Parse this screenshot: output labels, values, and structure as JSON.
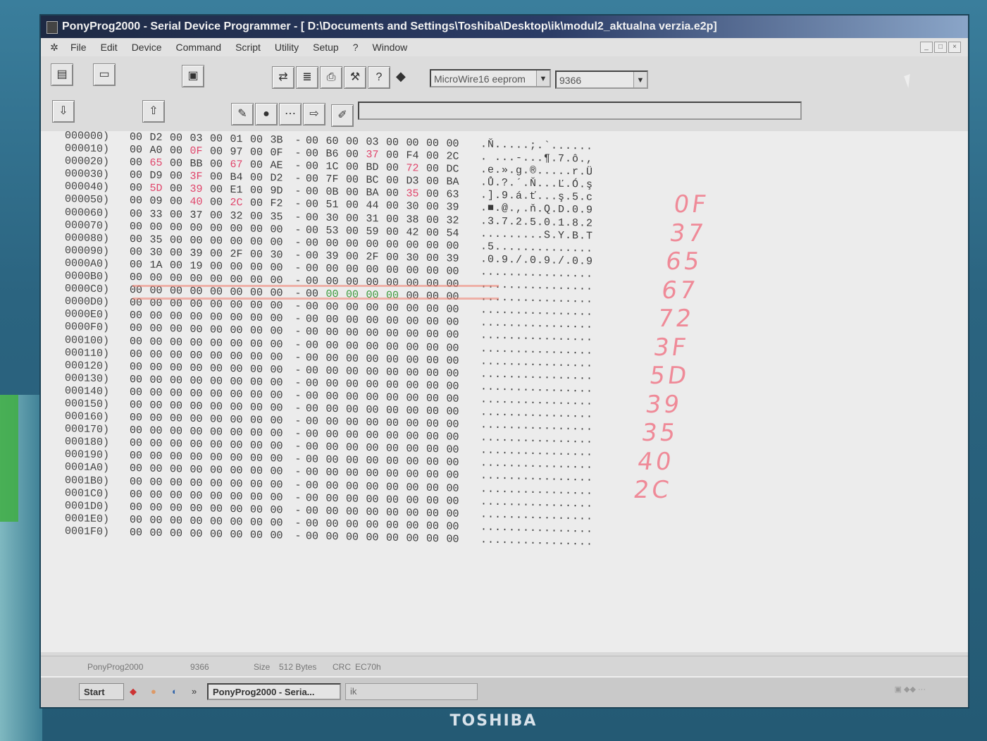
{
  "window": {
    "title": "PonyProg2000 - Serial Device Programmer - [ D:\\Documents and Settings\\Toshiba\\Desktop\\ik\\modul2_aktualna verzia.e2p]"
  },
  "menu": [
    "File",
    "Edit",
    "Device",
    "Command",
    "Script",
    "Utility",
    "Setup",
    "?",
    "Window"
  ],
  "toolbar": {
    "device_family": "MicroWire16 eeprom",
    "device_type": "9366"
  },
  "hex": {
    "rows": [
      {
        "addr": "000000)",
        "bytes": [
          "00",
          "D2",
          "00",
          "03",
          "00",
          "01",
          "00",
          "3B",
          "00",
          "60",
          "00",
          "03",
          "00",
          "00",
          "00",
          "00"
        ],
        "ascii": ".Ň.....;.`......"
      },
      {
        "addr": "000010)",
        "bytes": [
          "00",
          "A0",
          "00",
          "0F",
          "00",
          "97",
          "00",
          "0F",
          "00",
          "B6",
          "00",
          "37",
          "00",
          "F4",
          "00",
          "2C"
        ],
        "ascii": ". ...-...¶.7.ô.,"
      },
      {
        "addr": "000020)",
        "bytes": [
          "00",
          "65",
          "00",
          "BB",
          "00",
          "67",
          "00",
          "AE",
          "00",
          "1C",
          "00",
          "BD",
          "00",
          "72",
          "00",
          "DC"
        ],
        "ascii": ".e.».g.®.....r.Ü"
      },
      {
        "addr": "000030)",
        "bytes": [
          "00",
          "D9",
          "00",
          "3F",
          "00",
          "B4",
          "00",
          "D2",
          "00",
          "7F",
          "00",
          "BC",
          "00",
          "D3",
          "00",
          "BA"
        ],
        "ascii": ".Ů.?.´.Ň...Ľ.Ó.ş"
      },
      {
        "addr": "000040)",
        "bytes": [
          "00",
          "5D",
          "00",
          "39",
          "00",
          "E1",
          "00",
          "9D",
          "00",
          "0B",
          "00",
          "BA",
          "00",
          "35",
          "00",
          "63"
        ],
        "ascii": ".].9.á.ť...ş.5.c"
      },
      {
        "addr": "000050)",
        "bytes": [
          "00",
          "09",
          "00",
          "40",
          "00",
          "2C",
          "00",
          "F2",
          "00",
          "51",
          "00",
          "44",
          "00",
          "30",
          "00",
          "39"
        ],
        "ascii": ".■.@.,.ň.Q.D.0.9"
      },
      {
        "addr": "000060)",
        "bytes": [
          "00",
          "33",
          "00",
          "37",
          "00",
          "32",
          "00",
          "35",
          "00",
          "30",
          "00",
          "31",
          "00",
          "38",
          "00",
          "32"
        ],
        "ascii": ".3.7.2.5.0.1.8.2"
      },
      {
        "addr": "000070)",
        "bytes": [
          "00",
          "00",
          "00",
          "00",
          "00",
          "00",
          "00",
          "00",
          "00",
          "53",
          "00",
          "59",
          "00",
          "42",
          "00",
          "54"
        ],
        "ascii": ".........S.Y.B.T"
      },
      {
        "addr": "000080)",
        "bytes": [
          "00",
          "35",
          "00",
          "00",
          "00",
          "00",
          "00",
          "00",
          "00",
          "00",
          "00",
          "00",
          "00",
          "00",
          "00",
          "00"
        ],
        "ascii": ".5.............."
      },
      {
        "addr": "000090)",
        "bytes": [
          "00",
          "30",
          "00",
          "39",
          "00",
          "2F",
          "00",
          "30",
          "00",
          "39",
          "00",
          "2F",
          "00",
          "30",
          "00",
          "39"
        ],
        "ascii": ".0.9./.0.9./.0.9"
      },
      {
        "addr": "0000A0)",
        "bytes": [
          "00",
          "1A",
          "00",
          "19",
          "00",
          "00",
          "00",
          "00",
          "00",
          "00",
          "00",
          "00",
          "00",
          "00",
          "00",
          "00"
        ],
        "ascii": "................"
      },
      {
        "addr": "0000B0)",
        "bytes": [
          "00",
          "00",
          "00",
          "00",
          "00",
          "00",
          "00",
          "00",
          "00",
          "00",
          "00",
          "00",
          "00",
          "00",
          "00",
          "00"
        ],
        "ascii": "................"
      },
      {
        "addr": "0000C0)",
        "bytes": [
          "00",
          "00",
          "00",
          "00",
          "00",
          "00",
          "00",
          "00",
          "00",
          "00",
          "00",
          "00",
          "00",
          "00",
          "00",
          "00"
        ],
        "ascii": "................"
      },
      {
        "addr": "0000D0)",
        "bytes": [
          "00",
          "00",
          "00",
          "00",
          "00",
          "00",
          "00",
          "00",
          "00",
          "00",
          "00",
          "00",
          "00",
          "00",
          "00",
          "00"
        ],
        "ascii": "................"
      },
      {
        "addr": "0000E0)",
        "bytes": [
          "00",
          "00",
          "00",
          "00",
          "00",
          "00",
          "00",
          "00",
          "00",
          "00",
          "00",
          "00",
          "00",
          "00",
          "00",
          "00"
        ],
        "ascii": "................"
      },
      {
        "addr": "0000F0)",
        "bytes": [
          "00",
          "00",
          "00",
          "00",
          "00",
          "00",
          "00",
          "00",
          "00",
          "00",
          "00",
          "00",
          "00",
          "00",
          "00",
          "00"
        ],
        "ascii": "................"
      },
      {
        "addr": "000100)",
        "bytes": [
          "00",
          "00",
          "00",
          "00",
          "00",
          "00",
          "00",
          "00",
          "00",
          "00",
          "00",
          "00",
          "00",
          "00",
          "00",
          "00"
        ],
        "ascii": "................"
      },
      {
        "addr": "000110)",
        "bytes": [
          "00",
          "00",
          "00",
          "00",
          "00",
          "00",
          "00",
          "00",
          "00",
          "00",
          "00",
          "00",
          "00",
          "00",
          "00",
          "00"
        ],
        "ascii": "................"
      },
      {
        "addr": "000120)",
        "bytes": [
          "00",
          "00",
          "00",
          "00",
          "00",
          "00",
          "00",
          "00",
          "00",
          "00",
          "00",
          "00",
          "00",
          "00",
          "00",
          "00"
        ],
        "ascii": "................"
      },
      {
        "addr": "000130)",
        "bytes": [
          "00",
          "00",
          "00",
          "00",
          "00",
          "00",
          "00",
          "00",
          "00",
          "00",
          "00",
          "00",
          "00",
          "00",
          "00",
          "00"
        ],
        "ascii": "................"
      },
      {
        "addr": "000140)",
        "bytes": [
          "00",
          "00",
          "00",
          "00",
          "00",
          "00",
          "00",
          "00",
          "00",
          "00",
          "00",
          "00",
          "00",
          "00",
          "00",
          "00"
        ],
        "ascii": "................"
      },
      {
        "addr": "000150)",
        "bytes": [
          "00",
          "00",
          "00",
          "00",
          "00",
          "00",
          "00",
          "00",
          "00",
          "00",
          "00",
          "00",
          "00",
          "00",
          "00",
          "00"
        ],
        "ascii": "................"
      },
      {
        "addr": "000160)",
        "bytes": [
          "00",
          "00",
          "00",
          "00",
          "00",
          "00",
          "00",
          "00",
          "00",
          "00",
          "00",
          "00",
          "00",
          "00",
          "00",
          "00"
        ],
        "ascii": "................"
      },
      {
        "addr": "000170)",
        "bytes": [
          "00",
          "00",
          "00",
          "00",
          "00",
          "00",
          "00",
          "00",
          "00",
          "00",
          "00",
          "00",
          "00",
          "00",
          "00",
          "00"
        ],
        "ascii": "................"
      },
      {
        "addr": "000180)",
        "bytes": [
          "00",
          "00",
          "00",
          "00",
          "00",
          "00",
          "00",
          "00",
          "00",
          "00",
          "00",
          "00",
          "00",
          "00",
          "00",
          "00"
        ],
        "ascii": "................"
      },
      {
        "addr": "000190)",
        "bytes": [
          "00",
          "00",
          "00",
          "00",
          "00",
          "00",
          "00",
          "00",
          "00",
          "00",
          "00",
          "00",
          "00",
          "00",
          "00",
          "00"
        ],
        "ascii": "................"
      },
      {
        "addr": "0001A0)",
        "bytes": [
          "00",
          "00",
          "00",
          "00",
          "00",
          "00",
          "00",
          "00",
          "00",
          "00",
          "00",
          "00",
          "00",
          "00",
          "00",
          "00"
        ],
        "ascii": "................"
      },
      {
        "addr": "0001B0)",
        "bytes": [
          "00",
          "00",
          "00",
          "00",
          "00",
          "00",
          "00",
          "00",
          "00",
          "00",
          "00",
          "00",
          "00",
          "00",
          "00",
          "00"
        ],
        "ascii": "................"
      },
      {
        "addr": "0001C0)",
        "bytes": [
          "00",
          "00",
          "00",
          "00",
          "00",
          "00",
          "00",
          "00",
          "00",
          "00",
          "00",
          "00",
          "00",
          "00",
          "00",
          "00"
        ],
        "ascii": "................"
      },
      {
        "addr": "0001D0)",
        "bytes": [
          "00",
          "00",
          "00",
          "00",
          "00",
          "00",
          "00",
          "00",
          "00",
          "00",
          "00",
          "00",
          "00",
          "00",
          "00",
          "00"
        ],
        "ascii": "................"
      },
      {
        "addr": "0001E0)",
        "bytes": [
          "00",
          "00",
          "00",
          "00",
          "00",
          "00",
          "00",
          "00",
          "00",
          "00",
          "00",
          "00",
          "00",
          "00",
          "00",
          "00"
        ],
        "ascii": "................"
      },
      {
        "addr": "0001F0)",
        "bytes": [
          "00",
          "00",
          "00",
          "00",
          "00",
          "00",
          "00",
          "00",
          "00",
          "00",
          "00",
          "00",
          "00",
          "00",
          "00",
          "00"
        ],
        "ascii": "................"
      }
    ],
    "handwritten_notes": [
      "0F",
      "37",
      "65",
      "67",
      "72",
      "3F",
      "5D",
      "39",
      "35",
      "40",
      "2C"
    ]
  },
  "status": {
    "app": "PonyProg2000",
    "device": "9366",
    "size_label": "Size",
    "size_value": "512 Bytes",
    "crc_label": "CRC",
    "crc_value": "EC70h"
  },
  "taskbar": {
    "start": "Start",
    "task1": "PonyProg2000 - Seria...",
    "task2": "ik"
  },
  "brand": "TOSHIBA",
  "colors": {
    "title_bar": "#1e2a44",
    "highlight_byte": "#e0446a",
    "handwriting": "#f07a8a",
    "bezel": "#2f6a86"
  }
}
